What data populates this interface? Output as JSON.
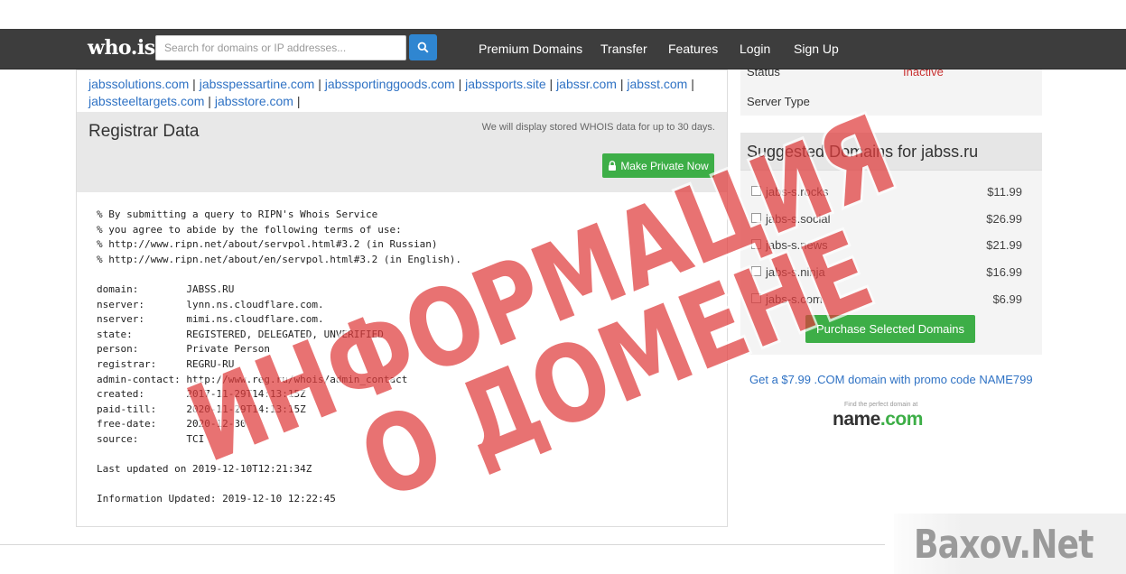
{
  "navbar": {
    "logo": "who.is",
    "search_placeholder": "Search for domains or IP addresses...",
    "links": [
      "Premium Domains",
      "Transfer",
      "Features",
      "Login",
      "Sign Up"
    ]
  },
  "domain_links": [
    "jabssolutions.com",
    "jabsspessartine.com",
    "jabssportinggoods.com",
    "jabssports.site",
    "jabssr.com",
    "jabsst.com",
    "jabssteeltargets.com",
    "jabsstore.com"
  ],
  "registrar": {
    "title": "Registrar Data",
    "note": "We will display stored WHOIS data for up to 30 days.",
    "private_button": "Make Private Now",
    "whois_text": "% By submitting a query to RIPN's Whois Service\n% you agree to abide by the following terms of use:\n% http://www.ripn.net/about/servpol.html#3.2 (in Russian)\n% http://www.ripn.net/about/en/servpol.html#3.2 (in English).\n\ndomain:        JABSS.RU\nnserver:       lynn.ns.cloudflare.com.\nnserver:       mimi.ns.cloudflare.com.\nstate:         REGISTERED, DELEGATED, UNVERIFIED\nperson:        Private Person\nregistrar:     REGRU-RU\nadmin-contact: http://www.reg.ru/whois/admin_contact\ncreated:       2017-11-29T14:13:15Z\npaid-till:     2020-11-29T14:13:15Z\nfree-date:     2020-12-30\nsource:        TCI\n\nLast updated on 2019-12-10T12:21:34Z\n\nInformation Updated: 2019-12-10 12:22:45"
  },
  "status_box": {
    "status_label": "Status",
    "status_value": "Inactive",
    "server_type_label": "Server Type"
  },
  "suggested": {
    "title": "Suggested Domains for jabss.ru",
    "items": [
      {
        "domain": "jabs-s.rocks",
        "price": "$11.99"
      },
      {
        "domain": "jabs-s.social",
        "price": "$26.99"
      },
      {
        "domain": "jabs-s.news",
        "price": "$21.99"
      },
      {
        "domain": "jabs-s.ninja",
        "price": "$16.99"
      },
      {
        "domain": "jabs-s.com",
        "price": "$6.99"
      }
    ],
    "purchase_button": "Purchase Selected Domains",
    "promo": "Get a $7.99 .COM domain with promo code NAME799",
    "namecom_tagline": "Find the perfect domain at",
    "namecom_name": "name",
    "namecom_tld": ".com"
  },
  "overlay": {
    "stamp_line1": "ИНФОРМАЦИЯ",
    "stamp_line2": "О ДОМЕНЕ",
    "stamp_color": "#e03c3c",
    "watermark": "Baxov.Net"
  },
  "colors": {
    "navbar": "#3d3d3d",
    "link": "#2f72c4",
    "green_button": "#3dae47",
    "search_button": "#2f86d1"
  }
}
